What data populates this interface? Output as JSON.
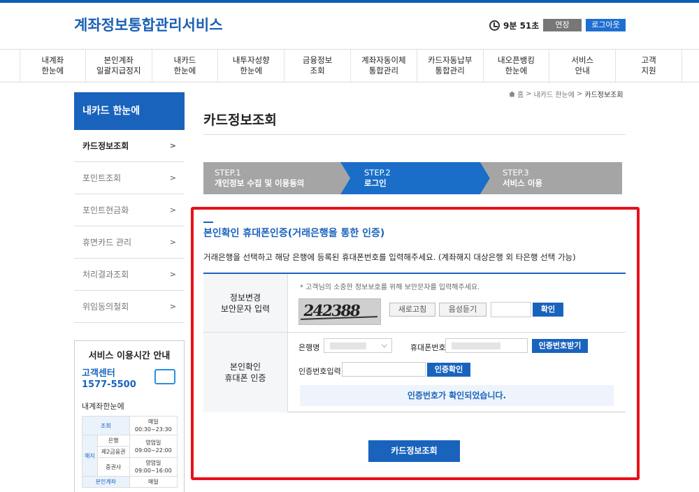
{
  "header": {
    "logo": "계좌정보통합관리서비스",
    "timer": "9분 51초",
    "extend_label": "연장",
    "logout_label": "로그아웃"
  },
  "gnb": [
    "내계좌\n한눈에",
    "본인계좌\n일괄지급정지",
    "내카드\n한눈에",
    "내투자성향\n한눈에",
    "금융정보\n조회",
    "계좌자동이체\n통합관리",
    "카드자동납부\n통합관리",
    "내오픈뱅킹\n한눈에",
    "서비스\n안내",
    "고객\n지원"
  ],
  "lnb": {
    "title": "내카드 한눈에",
    "items": [
      "카드정보조회",
      "포인트조회",
      "포인트현금화",
      "휴면카드 관리",
      "처리결과조회",
      "위임동의철회"
    ],
    "arrow": ">"
  },
  "service_hours": {
    "title": "서비스 이용시간 안내",
    "center_label": "고객센터",
    "center_phone": "1577-5500",
    "sub_title": "내계좌한눈에",
    "rows": {
      "inquiry": "조회",
      "daily": "매일",
      "inquiry_time": "00:30~23:30",
      "cancel": "해지",
      "bank": "은행",
      "bizday": "영업일",
      "bank_time": "09:00~22:00",
      "fin2": "제2금융권",
      "sec": "증권사",
      "sec_time": "09:00~16:00",
      "own_account": "본인계좌"
    }
  },
  "breadcrumb": {
    "home": "홈",
    "sep": ">",
    "level1": "내카드 한눈에",
    "current": "카드정보조회"
  },
  "page_title": "카드정보조회",
  "steps": [
    {
      "no": "STEP.1",
      "label": "개인정보 수집 및 이용동의"
    },
    {
      "no": "STEP.2",
      "label": "로그인"
    },
    {
      "no": "STEP.3",
      "label": "서비스 이용"
    }
  ],
  "section": {
    "title": "본인확인 휴대폰인증(거래은행을 통한 인증)",
    "desc": "거래은행을 선택하고 해당 은행에 등록된 휴대폰번호를 입력해주세요. (계좌해지 대상은행 외 타은행 선택 가능)"
  },
  "captcha_row": {
    "label": "정보변경\n보안문자 입력",
    "hint": "* 고객님의 소중한 정보보호를 위해 보안문자를 입력해주세요.",
    "captcha_text": "242388",
    "reload_label": "새로고침",
    "voice_label": "음성듣기",
    "confirm_label": "확인"
  },
  "phone_row": {
    "label": "본인확인\n휴대폰 인증",
    "bank_label": "은행명",
    "phone_label": "휴대폰번호",
    "request_label": "인증번호받기",
    "code_label": "인증번호입력",
    "verify_label": "인증확인",
    "message": "인증번호가 확인되었습니다."
  },
  "submit_label": "카드정보조회",
  "colors": {
    "primary": "#1a63bd",
    "step_inactive": "#a5a5a5",
    "highlight_frame": "#e8101a"
  }
}
